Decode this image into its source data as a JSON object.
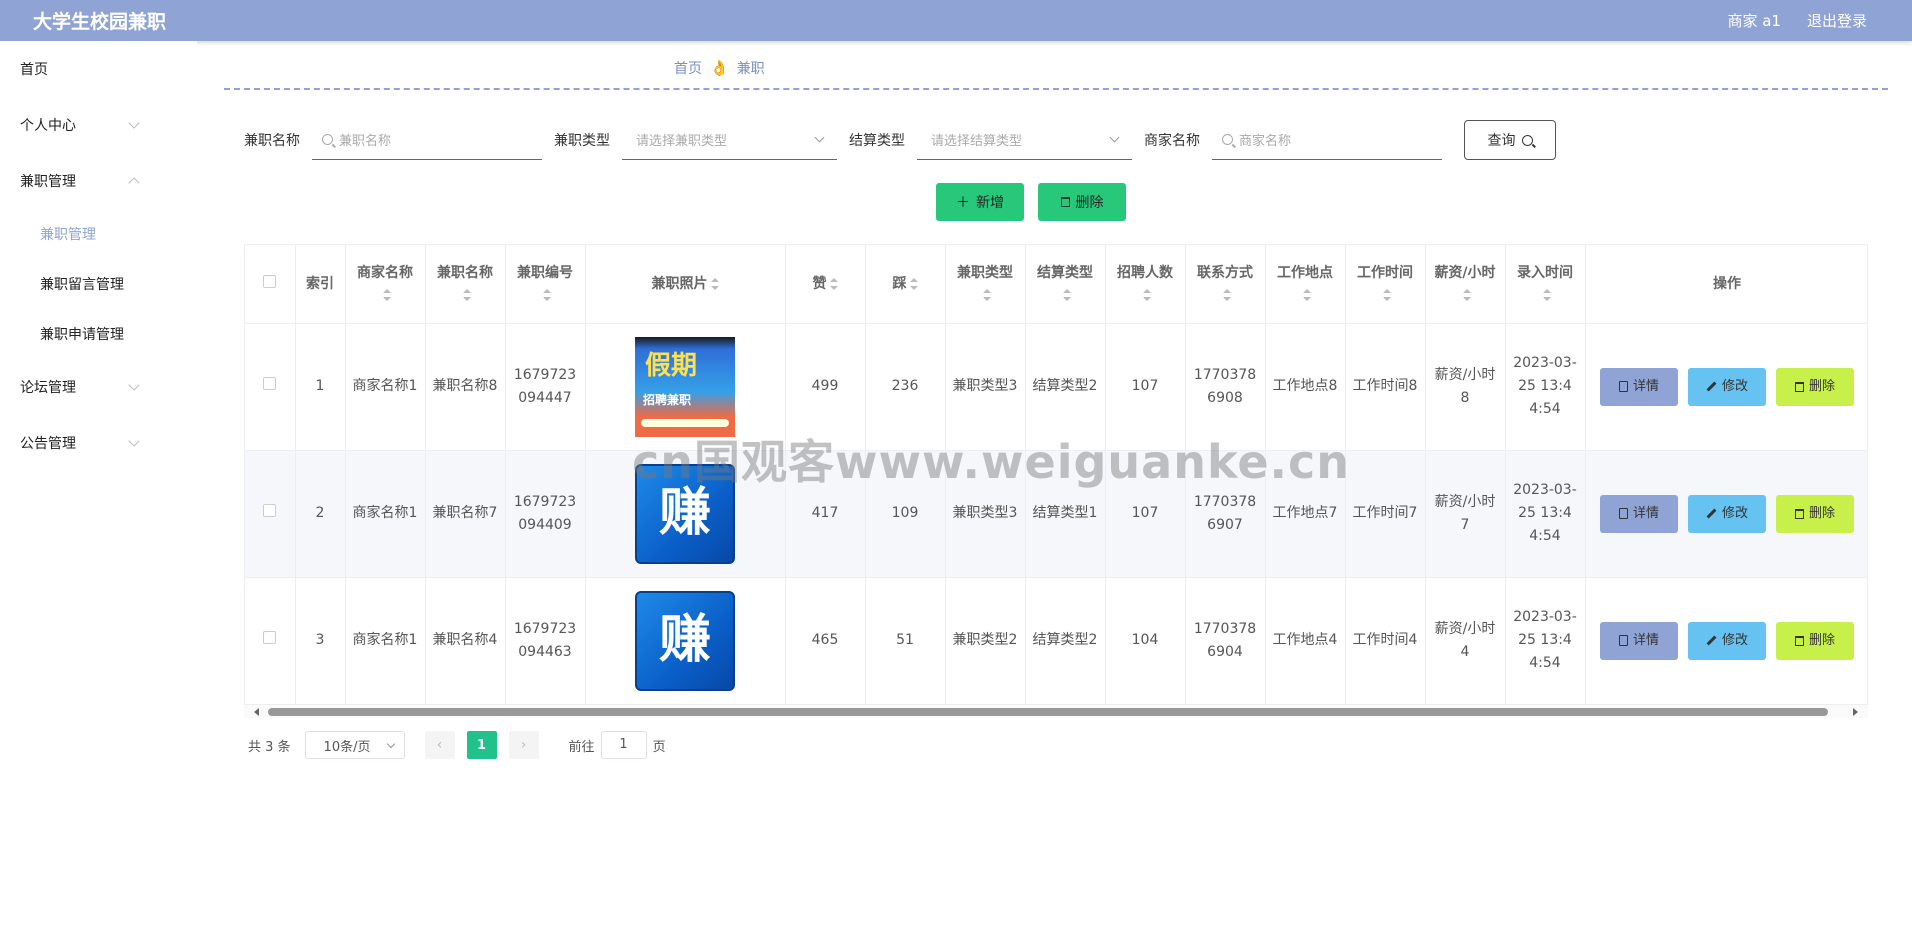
{
  "header": {
    "title": "大学生校园兼职",
    "user": "商家 a1",
    "logout": "退出登录"
  },
  "sidebar": {
    "home": "首页",
    "personal": "个人中心",
    "jobs": "兼职管理",
    "sub": [
      "兼职管理",
      "兼职留言管理",
      "兼职申请管理"
    ],
    "forum": "论坛管理",
    "notice": "公告管理"
  },
  "breadcrumb": {
    "home": "首页",
    "sep": "👌",
    "current": "兼职"
  },
  "search": {
    "name_label": "兼职名称",
    "name_placeholder": "兼职名称",
    "type_label": "兼职类型",
    "type_placeholder": "请选择兼职类型",
    "settle_label": "结算类型",
    "settle_placeholder": "请选择结算类型",
    "shop_label": "商家名称",
    "shop_placeholder": "商家名称",
    "query": "查询"
  },
  "actions": {
    "add": "新增",
    "delete": "删除"
  },
  "table": {
    "headers": [
      "索引",
      "商家名称",
      "兼职名称",
      "兼职编号",
      "兼职照片",
      "赞",
      "踩",
      "兼职类型",
      "结算类型",
      "招聘人数",
      "联系方式",
      "工作地点",
      "工作时间",
      "薪资/小时",
      "录入时间",
      "操作"
    ],
    "rows": [
      {
        "idx": "1",
        "shop": "商家名称1",
        "name": "兼职名称8",
        "code": "1679723094447",
        "photo": "poster",
        "up": "499",
        "down": "236",
        "jtype": "兼职类型3",
        "stype": "结算类型2",
        "count": "107",
        "phone": "17703786908",
        "place": "工作地点8",
        "time": "工作时间8",
        "pay": "薪资/小时8",
        "created": "2023-03-25 13:44:54"
      },
      {
        "idx": "2",
        "shop": "商家名称1",
        "name": "兼职名称7",
        "code": "1679723094409",
        "photo": "zhuan",
        "up": "417",
        "down": "109",
        "jtype": "兼职类型3",
        "stype": "结算类型1",
        "count": "107",
        "phone": "17703786907",
        "place": "工作地点7",
        "time": "工作时间7",
        "pay": "薪资/小时7",
        "created": "2023-03-25 13:44:54"
      },
      {
        "idx": "3",
        "shop": "商家名称1",
        "name": "兼职名称4",
        "code": "1679723094463",
        "photo": "zhuan",
        "up": "465",
        "down": "51",
        "jtype": "兼职类型2",
        "stype": "结算类型2",
        "count": "104",
        "phone": "17703786904",
        "place": "工作地点4",
        "time": "工作时间4",
        "pay": "薪资/小时4",
        "created": "2023-03-25 13:44:54"
      }
    ],
    "op_detail": "详情",
    "op_edit": "修改",
    "op_delete": "删除",
    "poster_text1": "假期",
    "poster_text2": "招聘兼职",
    "zhuan_char": "赚"
  },
  "pager": {
    "total": "共 3 条",
    "size": "10条/页",
    "page": "1",
    "goto": "前往",
    "goto_value": "1",
    "unit": "页"
  },
  "watermark": "cn国观客www.weiguanke.cn",
  "colors": {
    "header": "#8fa4d4",
    "primary_green": "#28c87a",
    "pager_active": "#1ec28a"
  }
}
